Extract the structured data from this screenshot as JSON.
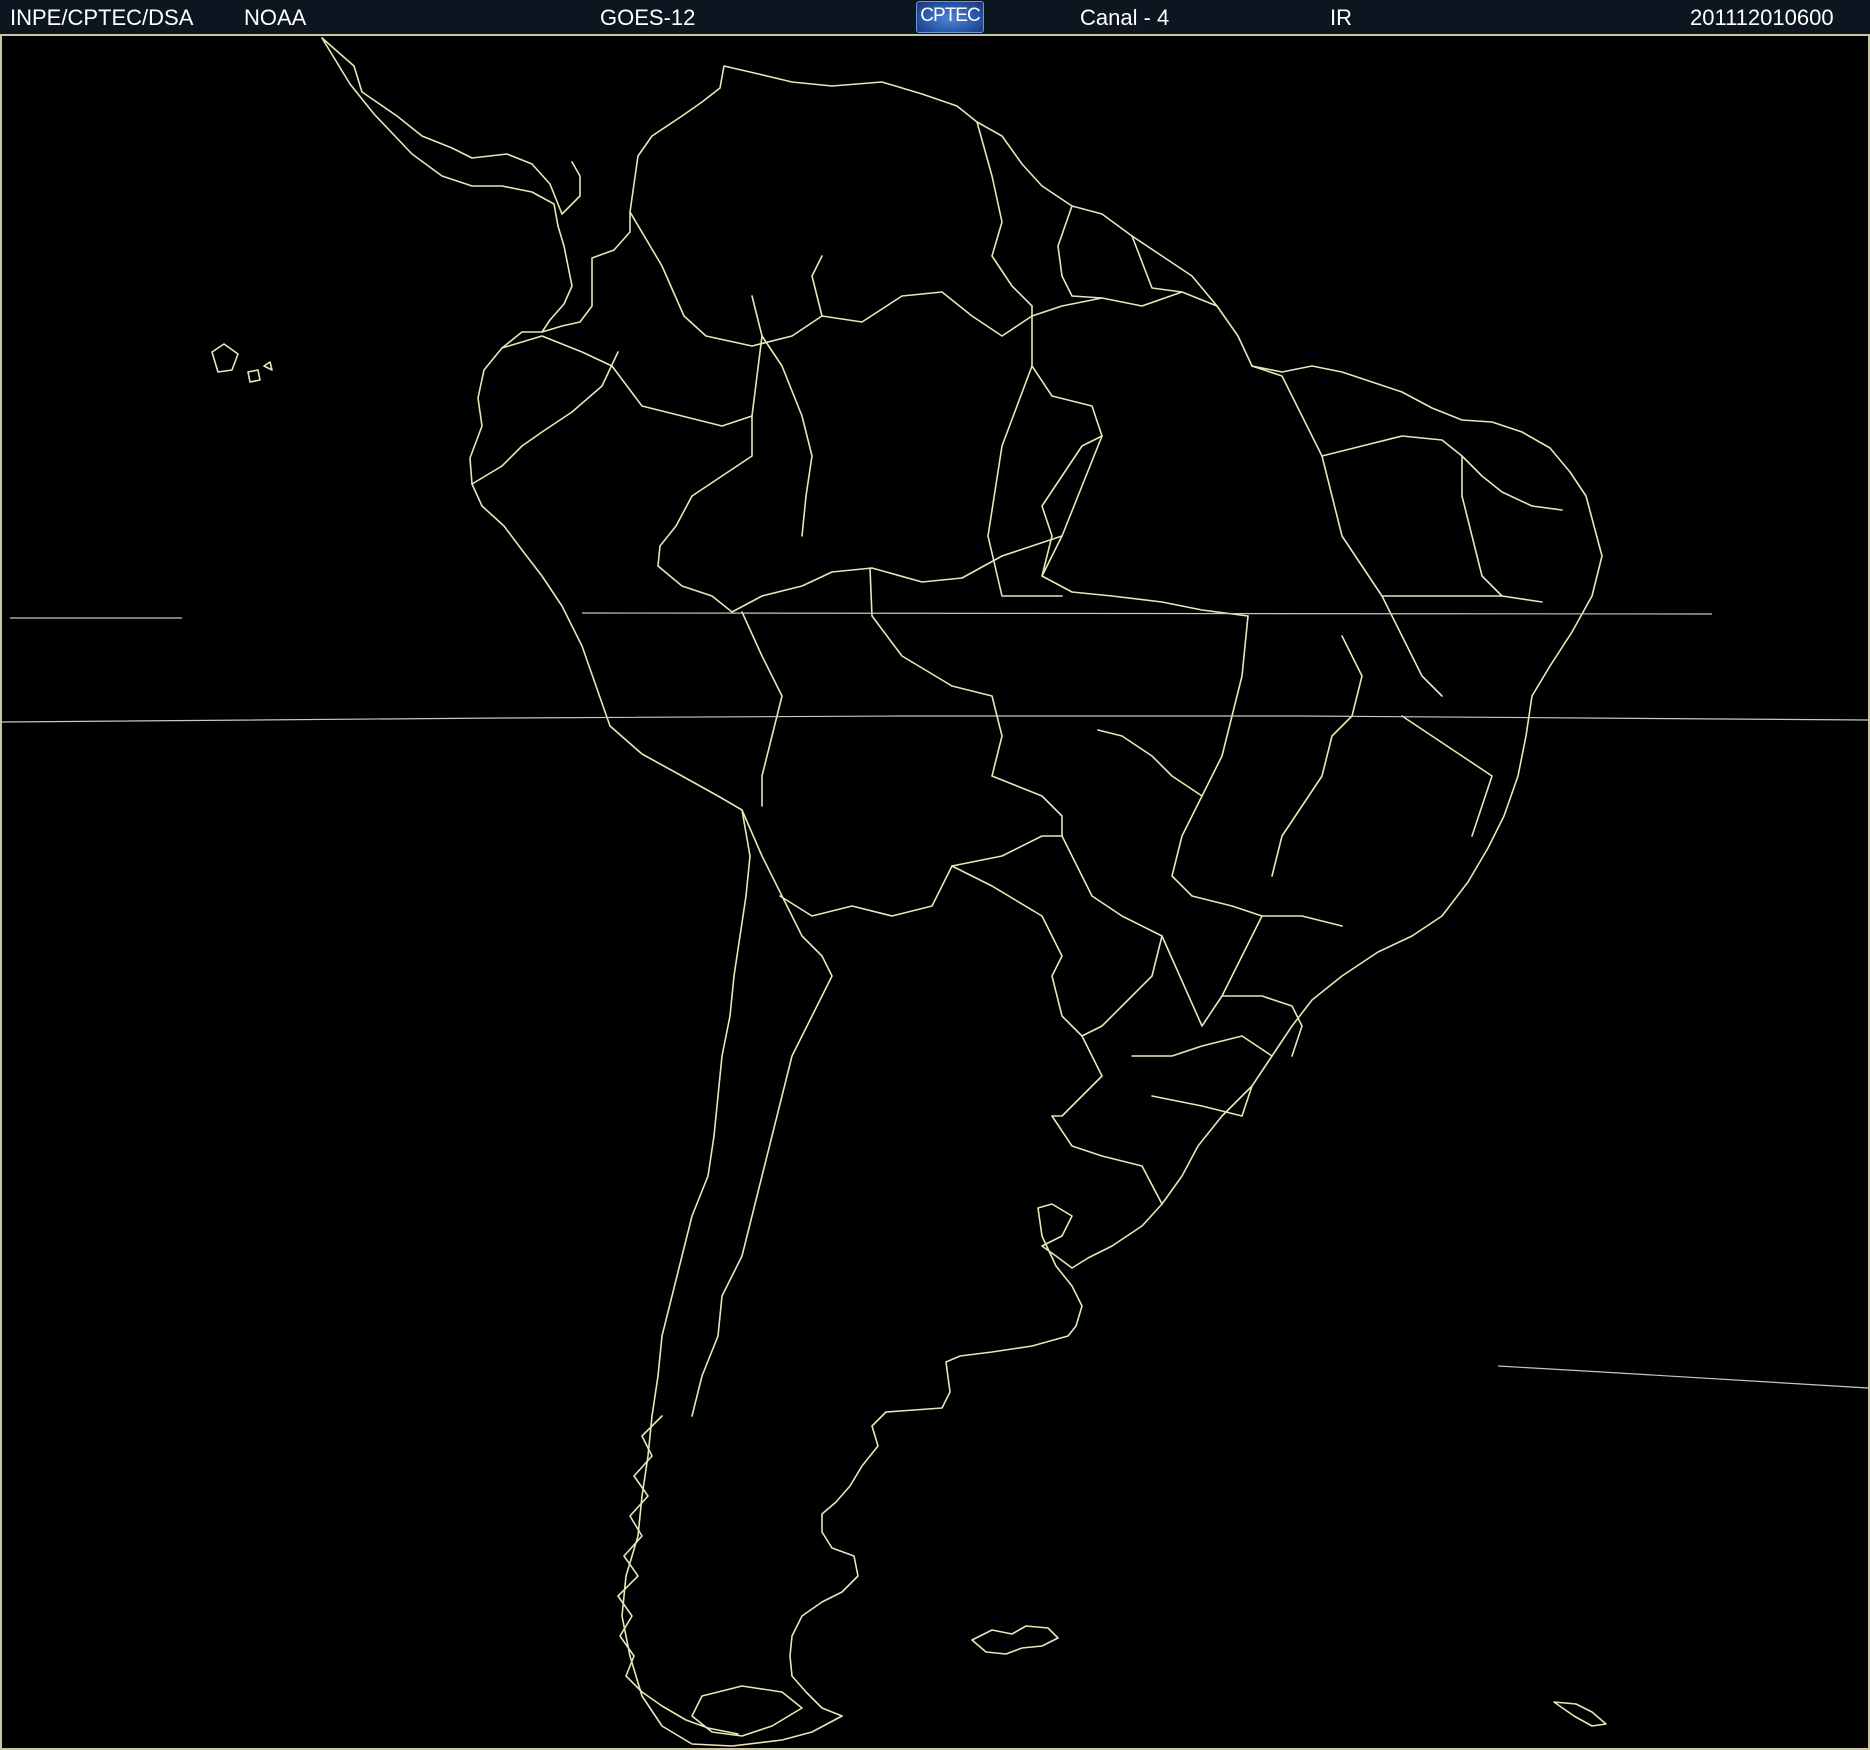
{
  "header": {
    "agency": "INPE/CPTEC/DSA",
    "provider": "NOAA",
    "satellite": "GOES-12",
    "logo_text": "CPTEC",
    "channel": "Canal - 4",
    "band": "IR",
    "timestamp": "201112010600"
  },
  "colors": {
    "background": "#000000",
    "header_background": "#0d1620",
    "header_text": "#ffffff",
    "boundary_lines": "#e8e6b8",
    "logo_blue": "#2855a8"
  },
  "icons": {
    "logo": "cptec-logo"
  }
}
